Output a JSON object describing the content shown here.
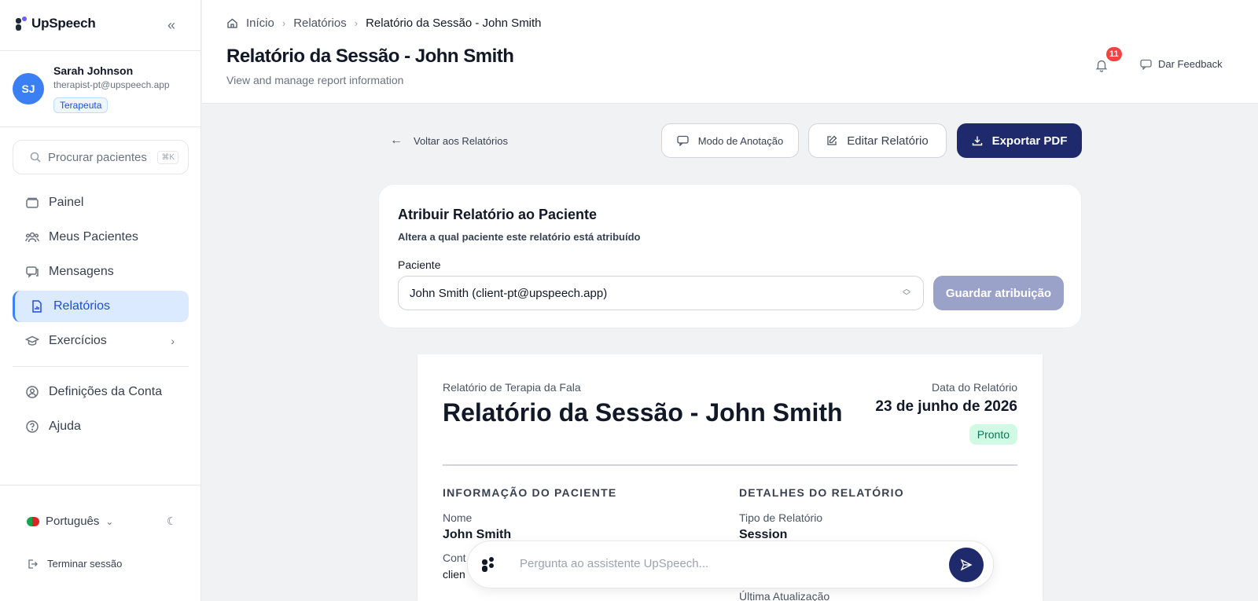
{
  "app": {
    "name": "UpSpeech"
  },
  "user": {
    "initials": "SJ",
    "name": "Sarah Johnson",
    "email": "therapist-pt@upspeech.app",
    "role": "Terapeuta"
  },
  "search": {
    "placeholder": "Procurar pacientes",
    "shortcut": "⌘K"
  },
  "nav": {
    "items": [
      {
        "label": "Painel",
        "icon": "folder-icon"
      },
      {
        "label": "Meus Pacientes",
        "icon": "users-icon"
      },
      {
        "label": "Mensagens",
        "icon": "chat-icon"
      },
      {
        "label": "Relatórios",
        "icon": "report-icon",
        "active": true
      },
      {
        "label": "Exercícios",
        "icon": "graduation-cap-icon"
      }
    ],
    "secondary": [
      {
        "label": "Definições da Conta",
        "icon": "user-circle-icon"
      },
      {
        "label": "Ajuda",
        "icon": "help-icon"
      }
    ]
  },
  "footer": {
    "language": "Português",
    "logout": "Terminar sessão"
  },
  "header": {
    "breadcrumb": [
      "Início",
      "Relatórios",
      "Relatório da Sessão - John Smith"
    ],
    "title": "Relatório da Sessão - John Smith",
    "subtitle": "View and manage report information",
    "notifications": "11",
    "feedback": "Dar Feedback"
  },
  "actions": {
    "back": "Voltar aos Relatórios",
    "annotation": "Modo de Anotação",
    "edit": "Editar Relatório",
    "export": "Exportar PDF"
  },
  "assign": {
    "title": "Atribuir Relatório ao Paciente",
    "subtitle": "Altera a qual paciente este relatório está atribuído",
    "label": "Paciente",
    "selected": "John Smith (client-pt@upspeech.app)",
    "save": "Guardar atribuição"
  },
  "report": {
    "kind": "Relatório de Terapia da Fala",
    "title": "Relatório da Sessão - John Smith",
    "date_label": "Data do Relatório",
    "date": "23 de junho de 2026",
    "status": "Pronto",
    "patient_section": "INFORMAÇÃO DO PACIENTE",
    "details_section": "DETALHES DO RELATÓRIO",
    "name_label": "Nome",
    "name_value": "John Smith",
    "contact_label": "Cont",
    "contact_value": "clien",
    "type_label": "Tipo de Relatório",
    "type_value": "Session",
    "updated_label": "Última Atualização"
  },
  "assistant": {
    "placeholder": "Pergunta ao assistente UpSpeech..."
  },
  "colors": {
    "primary": "#1e2a6b",
    "accent": "#3b7ff5",
    "active_bg": "#dbeafe",
    "badge": "#ef4444",
    "status_bg": "#d1fae5"
  }
}
